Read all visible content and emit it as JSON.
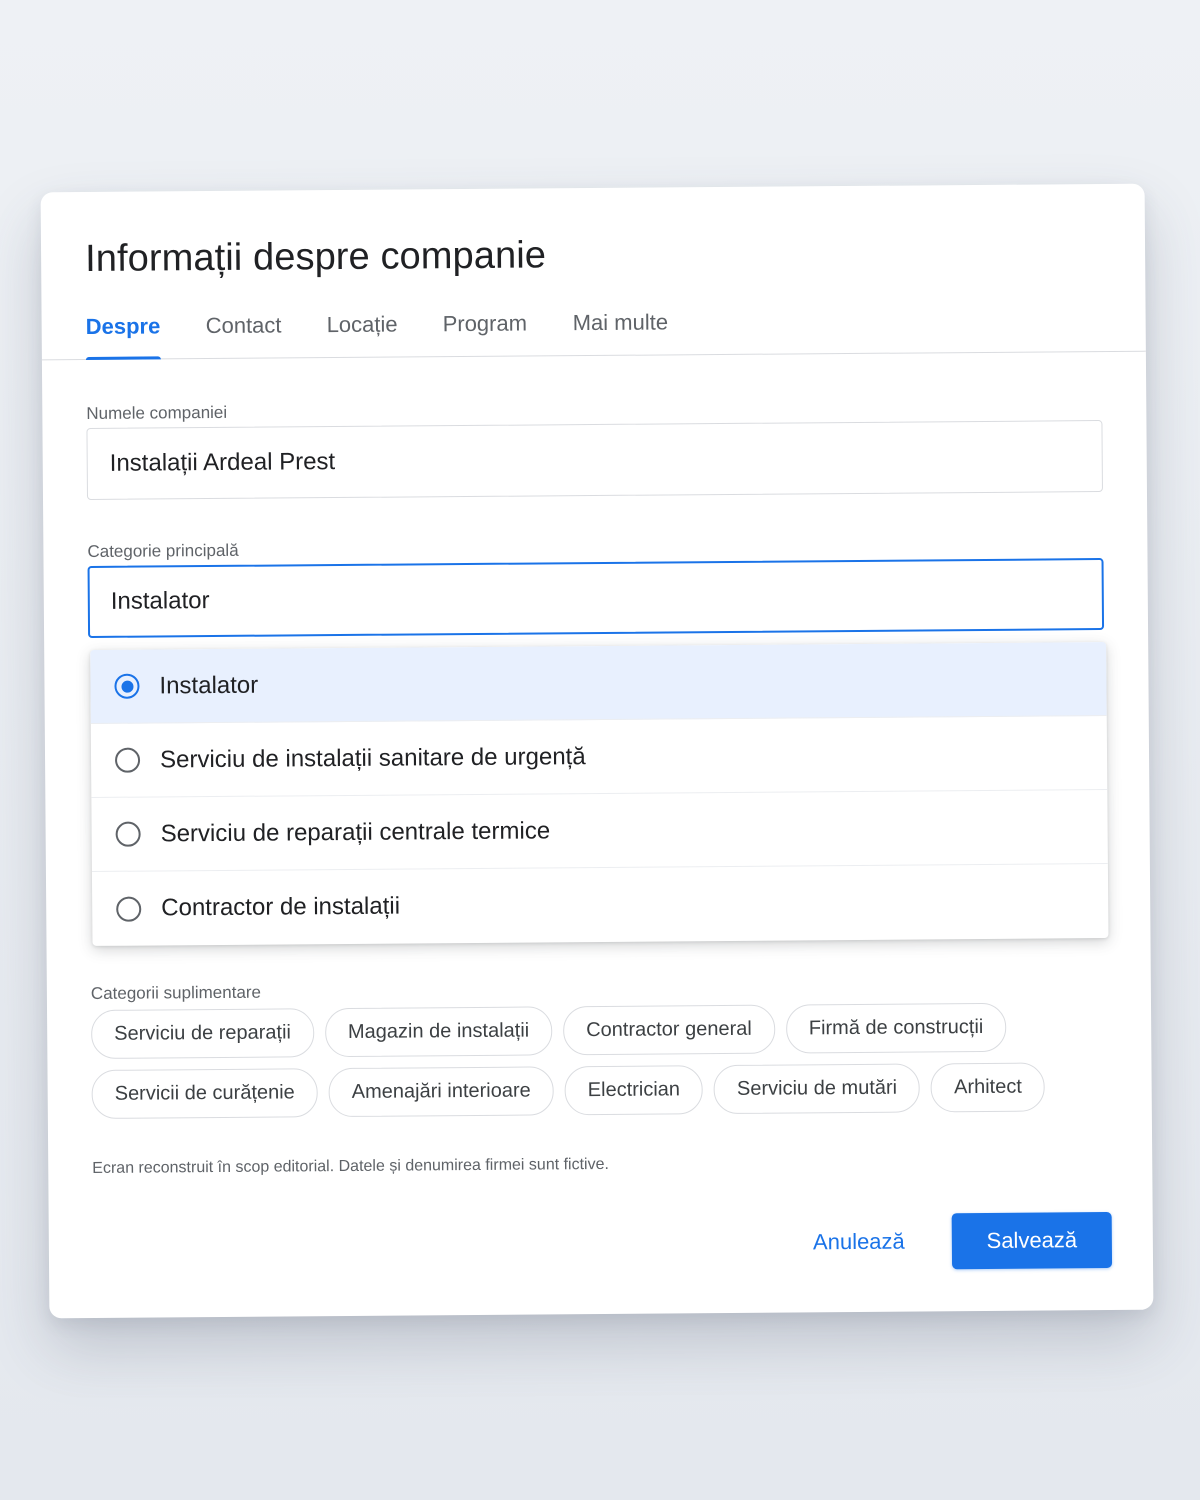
{
  "dialog": {
    "title": "Informații despre companie",
    "tabs": [
      {
        "label": "Despre",
        "active": true
      },
      {
        "label": "Contact",
        "active": false
      },
      {
        "label": "Locație",
        "active": false
      },
      {
        "label": "Program",
        "active": false
      },
      {
        "label": "Mai multe",
        "active": false
      }
    ]
  },
  "form": {
    "company_name": {
      "label": "Numele companiei",
      "value": "Instalații Ardeal Prest"
    },
    "primary_category": {
      "label": "Categorie principală",
      "value": "Instalator"
    },
    "dropdown_options": [
      {
        "label": "Instalator",
        "selected": true
      },
      {
        "label": "Serviciu de instalații sanitare de urgență",
        "selected": false
      },
      {
        "label": "Serviciu de reparații centrale termice",
        "selected": false
      },
      {
        "label": "Contractor de instalații",
        "selected": false
      }
    ],
    "additional_categories": {
      "label": "Categorii suplimentare",
      "rows": [
        [
          "Serviciu de reparații",
          "Magazin de instalații",
          "Contractor general",
          "Firmă de construcții"
        ],
        [
          "Servicii de curățenie",
          "Amenajări interioare",
          "Electrician",
          "Serviciu de mutări",
          "Arhitect"
        ]
      ]
    },
    "note": "Ecran reconstruit în scop editorial. Datele și denumirea firmei sunt fictive."
  },
  "actions": {
    "cancel_label": "Anulează",
    "save_label": "Salvează"
  },
  "colors": {
    "accent": "#1a73e8",
    "selected_bg": "#e8f0fe",
    "background": "#e9ecf1"
  }
}
